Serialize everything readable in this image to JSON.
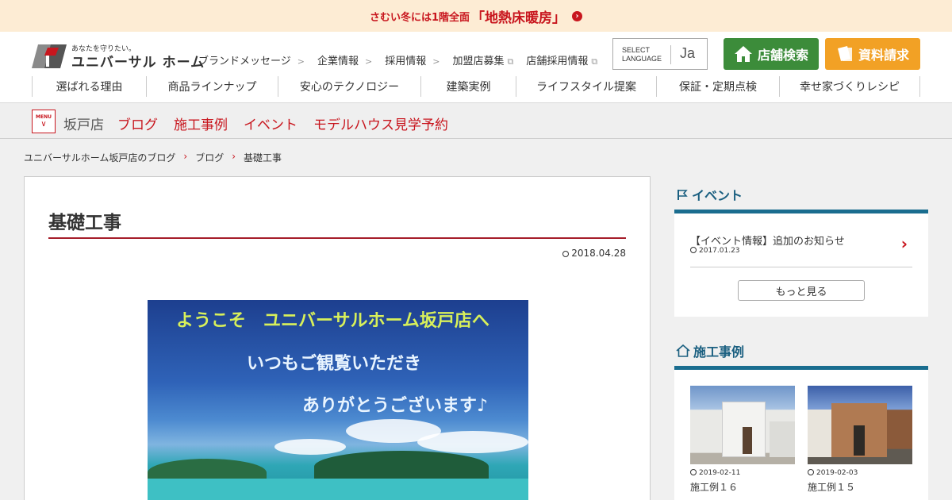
{
  "promo": {
    "prefix": "さむい冬には1階全面",
    "highlight": "「地熱床暖房」",
    "arrow_icon": "circle-chevron-right-icon"
  },
  "header": {
    "logo_tagline": "あなたを守りたい。",
    "logo_name": "ユニバーサル ホーム",
    "util_links": [
      {
        "label": "ブランドメッセージ",
        "icon": "chevron-right-icon"
      },
      {
        "label": "企業情報",
        "icon": "chevron-right-icon"
      },
      {
        "label": "採用情報",
        "icon": "chevron-right-icon"
      },
      {
        "label": "加盟店募集",
        "icon": "external-link-icon"
      },
      {
        "label": "店舗採用情報",
        "icon": "external-link-icon"
      }
    ],
    "language": {
      "label_line1": "SELECT",
      "label_line2": "LANGUAGE",
      "value": "Ja"
    },
    "store_search_label": "店舗検索",
    "brochure_label": "資料請求",
    "colors": {
      "green": "#3c8c3a",
      "orange": "#f2a125",
      "red": "#c8161e"
    }
  },
  "main_nav": [
    "選ばれる理由",
    "商品ラインナップ",
    "安心のテクノロジー",
    "建築実例",
    "ライフスタイル提案",
    "保証・定期点検",
    "幸せ家づくりレシピ"
  ],
  "subbar": {
    "menu_label": "MENU",
    "store_name": "坂戸店",
    "links": [
      "ブログ",
      "施工事例",
      "イベント",
      "モデルハウス見学予約"
    ]
  },
  "breadcrumb": [
    "ユニバーサルホーム坂戸店のブログ",
    "ブログ",
    "基礎工事"
  ],
  "article": {
    "title": "基礎工事",
    "date": "2018.04.28",
    "hero_lines": [
      "ようこそ　ユニバーサルホーム坂戸店へ",
      "いつもご観覧いただき",
      "ありがとうございます♪"
    ]
  },
  "sidebar": {
    "events": {
      "title": "イベント",
      "items": [
        {
          "title": "【イベント情報】追加のお知らせ",
          "date": "2017.01.23"
        }
      ],
      "more_label": "もっと見る"
    },
    "cases": {
      "title": "施工事例",
      "items": [
        {
          "date": "2019-02-11",
          "name": "施工例１６"
        },
        {
          "date": "2019-02-03",
          "name": "施工例１５"
        }
      ]
    }
  }
}
